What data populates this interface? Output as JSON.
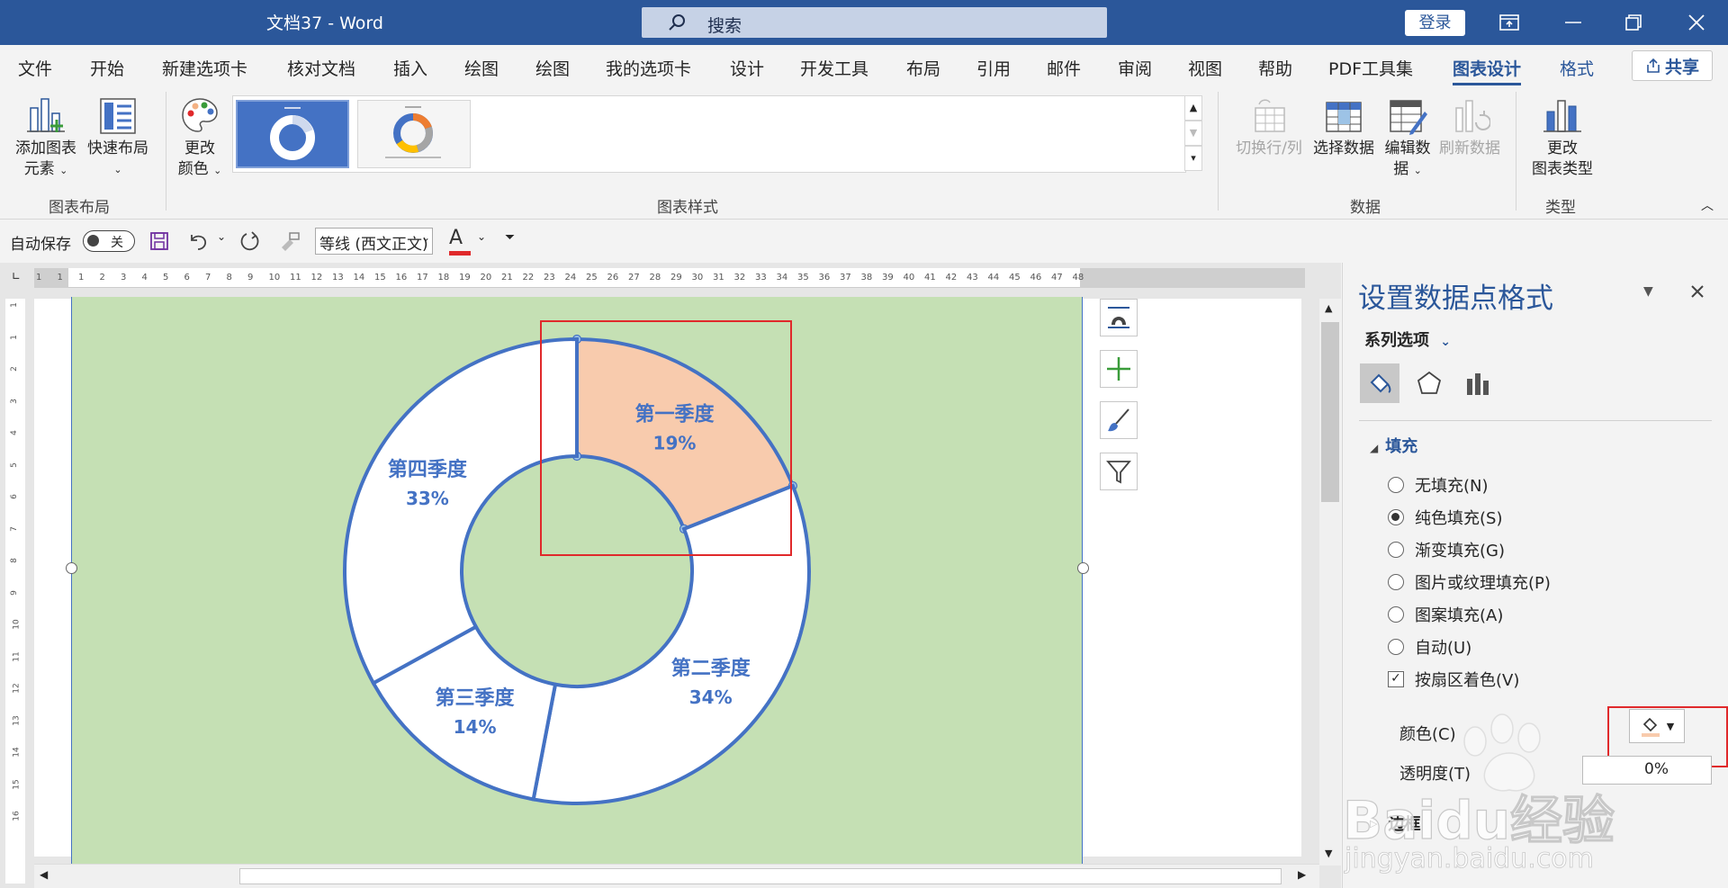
{
  "titlebar": {
    "doc_title": "文档37  -  Word",
    "search_placeholder": "搜索",
    "login_label": "登录"
  },
  "menu": {
    "tabs": [
      "文件",
      "开始",
      "新建选项卡",
      "核对文档",
      "插入",
      "绘图",
      "绘图",
      "我的选项卡",
      "设计",
      "开发工具",
      "布局",
      "引用",
      "邮件",
      "审阅",
      "视图",
      "帮助",
      "PDF工具集",
      "图表设计",
      "格式"
    ],
    "active_tab": "图表设计",
    "share_label": "共享"
  },
  "ribbon": {
    "add_element_l1": "添加图表",
    "add_element_l2": "元素",
    "quick_layout": "快速布局",
    "change_colors_l1": "更改",
    "change_colors_l2": "颜色",
    "group_layout": "图表布局",
    "group_styles": "图表样式",
    "switch_row_col": "切换行/列",
    "select_data": "选择数据",
    "edit_data_l1": "编辑数",
    "edit_data_l2": "据",
    "refresh_data": "刷新数据",
    "group_data": "数据",
    "change_type_l1": "更改",
    "change_type_l2": "图表类型",
    "group_type": "类型"
  },
  "qat": {
    "autosave": "自动保存",
    "toggle_state": "关",
    "font": "等线 (西文正文)"
  },
  "ruler": {
    "h_ticks": [
      "1",
      "1",
      "1",
      "2",
      "3",
      "4",
      "5",
      "6",
      "7",
      "8",
      "9",
      "10",
      "11",
      "12",
      "13",
      "14",
      "15",
      "16",
      "17",
      "18",
      "19",
      "20",
      "21",
      "22",
      "23",
      "24",
      "25",
      "26",
      "27",
      "28",
      "29",
      "30",
      "31",
      "32",
      "33",
      "34",
      "35",
      "36",
      "37",
      "38",
      "39",
      "40",
      "41",
      "42",
      "43",
      "44",
      "45",
      "46",
      "47",
      "48"
    ],
    "v_ticks": [
      "1",
      "1",
      "2",
      "3",
      "4",
      "5",
      "6",
      "7",
      "8",
      "9",
      "10",
      "11",
      "12",
      "13",
      "14",
      "15",
      "16"
    ]
  },
  "chart_data": {
    "type": "pie",
    "variant": "doughnut",
    "categories": [
      "第一季度",
      "第二季度",
      "第三季度",
      "第四季度"
    ],
    "values": [
      19,
      34,
      14,
      33
    ],
    "labels": [
      "19%",
      "34%",
      "14%",
      "33%"
    ],
    "highlight_category": "第一季度",
    "colors": {
      "highlight": "#f8cbad",
      "default": "#ffffff",
      "border": "#4472c4",
      "background": "#c5e0b4",
      "label": "#4472c4"
    }
  },
  "pane": {
    "title": "设置数据点格式",
    "series_options": "系列选项",
    "section_fill": "填充",
    "fill_options": [
      "无填充(N)",
      "纯色填充(S)",
      "渐变填充(G)",
      "图片或纹理填充(P)",
      "图案填充(A)",
      "自动(U)"
    ],
    "selected_fill": "纯色填充(S)",
    "vary_by_point": "按扇区着色(V)",
    "color_label": "颜色(C)",
    "transparency_label": "透明度(T)",
    "transparency_value": "0%",
    "section_border": "边框",
    "fill_color": "#f8cbad"
  },
  "watermark": {
    "brand": "Baidu经验",
    "url": "jingyan.baidu.com"
  }
}
